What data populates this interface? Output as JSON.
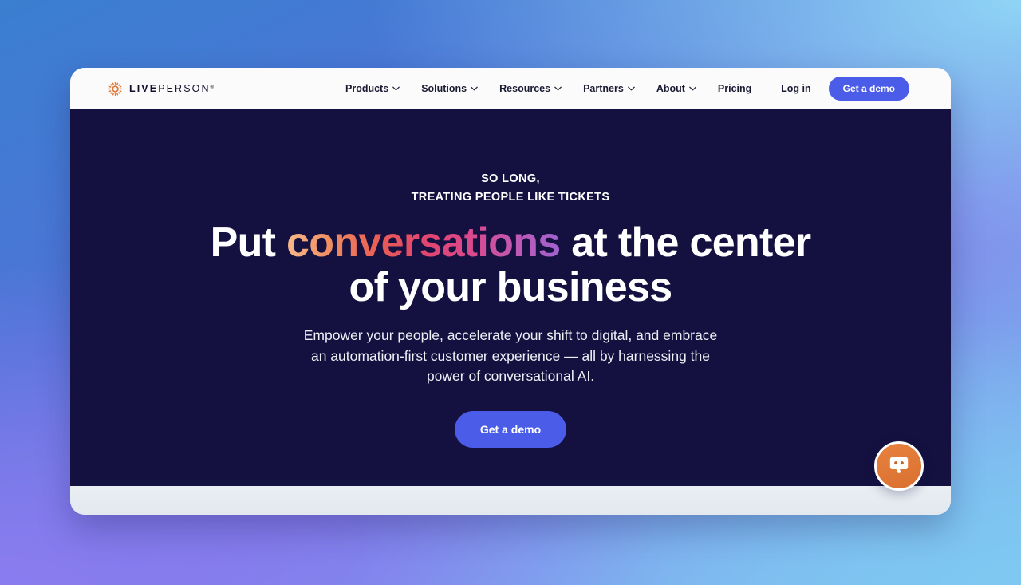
{
  "brand": {
    "logo_icon": "liveperson-sun-gear-icon",
    "name_bold": "LIVE",
    "name_light": "PERSON",
    "registered_mark": "®",
    "accent_color": "#e07a3c",
    "cta_color": "#4a5ce8",
    "hero_bg_color": "#141141"
  },
  "header": {
    "nav": [
      {
        "label": "Products",
        "has_dropdown": true,
        "icon": "chevron-down-icon"
      },
      {
        "label": "Solutions",
        "has_dropdown": true,
        "icon": "chevron-down-icon"
      },
      {
        "label": "Resources",
        "has_dropdown": true,
        "icon": "chevron-down-icon"
      },
      {
        "label": "Partners",
        "has_dropdown": true,
        "icon": "chevron-down-icon"
      },
      {
        "label": "About",
        "has_dropdown": true,
        "icon": "chevron-down-icon"
      },
      {
        "label": "Pricing",
        "has_dropdown": false,
        "icon": ""
      }
    ],
    "login_label": "Log in",
    "demo_label": "Get a demo"
  },
  "hero": {
    "eyebrow_line1": "SO LONG,",
    "eyebrow_line2": "TREATING PEOPLE LIKE TICKETS",
    "headline_part1": "Put ",
    "headline_highlight": "conversations",
    "headline_part2": " at the center of your business",
    "subhead": "Empower your people, accelerate your shift to digital, and embrace an automation-first customer experience — all by harnessing the power of conversational AI.",
    "cta_label": "Get a demo",
    "highlight_gradient_from": "#f6b98a",
    "highlight_gradient_to": "#9e62cf"
  },
  "chat": {
    "icon": "chat-bot-face-icon",
    "color": "#e0782f"
  }
}
